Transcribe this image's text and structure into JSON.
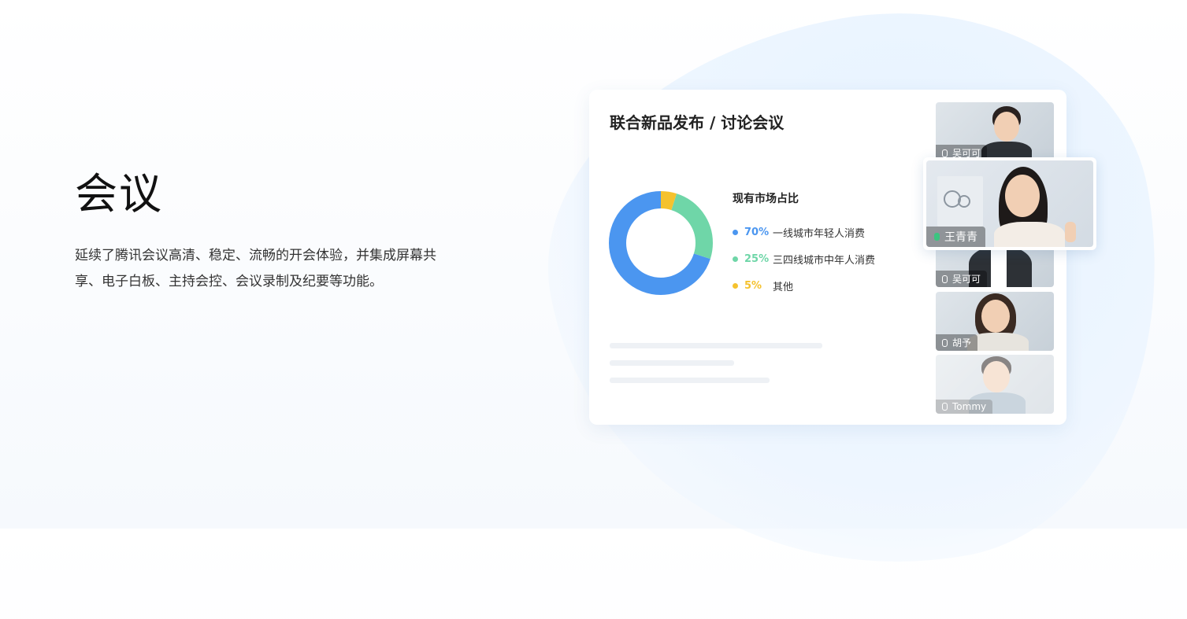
{
  "hero": {
    "title": "会议",
    "description": "延续了腾讯会议高清、稳定、流畅的开会体验，并集成屏幕共享、电子白板、主持会控、会议录制及纪要等功能。"
  },
  "meeting": {
    "title": "联合新品发布 / 讨论会议",
    "chart_title": "现有市场占比",
    "legend": [
      {
        "pct": "70%",
        "label": "一线城市年轻人消费",
        "color": "#4b96f0"
      },
      {
        "pct": "25%",
        "label": "三四线城市中年人消费",
        "color": "#6fd6a8"
      },
      {
        "pct": "5%",
        "label": "其他",
        "color": "#f5c22e"
      }
    ]
  },
  "chart_data": {
    "type": "pie",
    "title": "现有市场占比",
    "categories": [
      "一线城市年轻人消费",
      "三四线城市中年人消费",
      "其他"
    ],
    "values": [
      70,
      25,
      5
    ],
    "colors": [
      "#4b96f0",
      "#6fd6a8",
      "#f5c22e"
    ]
  },
  "participants": [
    {
      "name": "吴可可"
    },
    {
      "name": "王青青",
      "speaking": true
    },
    {
      "name": "吴可可"
    },
    {
      "name": "胡予"
    },
    {
      "name": "Tommy"
    }
  ]
}
